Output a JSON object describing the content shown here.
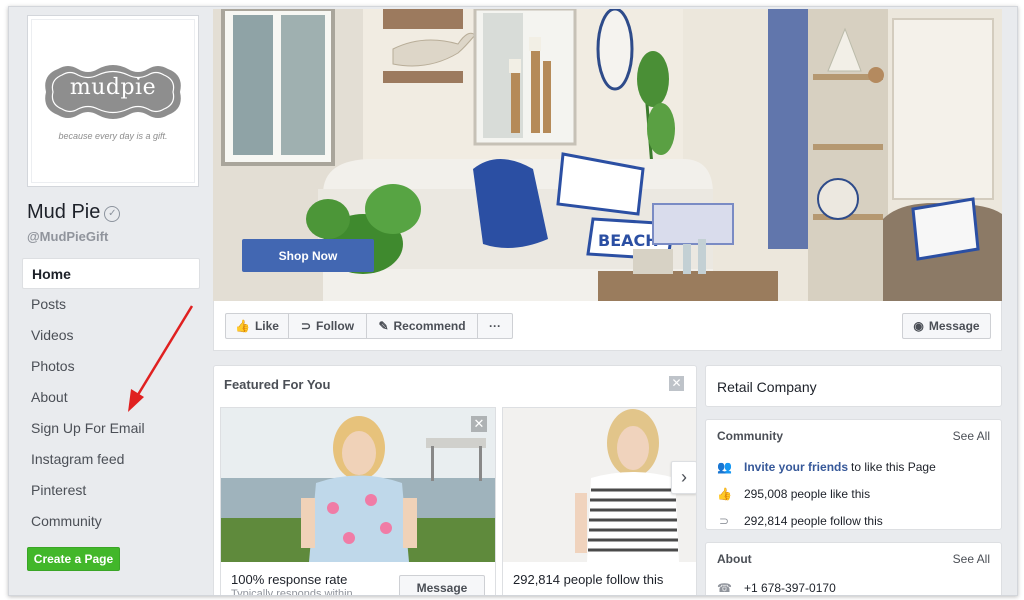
{
  "page": {
    "name": "Mud Pie",
    "handle": "@MudPieGift",
    "logo_text": "mudpie",
    "logo_tagline": "because every day is a gift."
  },
  "nav": {
    "items": [
      {
        "label": "Home",
        "active": true
      },
      {
        "label": "Posts"
      },
      {
        "label": "Videos"
      },
      {
        "label": "Photos"
      },
      {
        "label": "About"
      },
      {
        "label": "Sign Up For Email"
      },
      {
        "label": "Instagram feed"
      },
      {
        "label": "Pinterest"
      },
      {
        "label": "Community"
      }
    ],
    "create_page": "Create a Page"
  },
  "cover": {
    "cta": "Shop Now",
    "pillow_text": "BEACH"
  },
  "actions": {
    "like": "Like",
    "follow": "Follow",
    "recommend": "Recommend",
    "more": "···",
    "message": "Message"
  },
  "featured": {
    "title": "Featured For You",
    "items": [
      {
        "caption": "100% response rate",
        "sub": "Typically responds within",
        "button": "Message"
      },
      {
        "caption": "292,814 people follow this"
      }
    ]
  },
  "category": "Retail Company",
  "community": {
    "title": "Community",
    "see_all": "See All",
    "invite_link": "Invite your friends",
    "invite_rest": "to like this Page",
    "likes": "295,008 people like this",
    "follows": "292,814 people follow this"
  },
  "about": {
    "title": "About",
    "see_all": "See All",
    "phone": "+1 678-397-0170"
  },
  "colors": {
    "fb_blue": "#4267b2",
    "green": "#42b72a",
    "link": "#365899",
    "annotation": "#e02020"
  }
}
